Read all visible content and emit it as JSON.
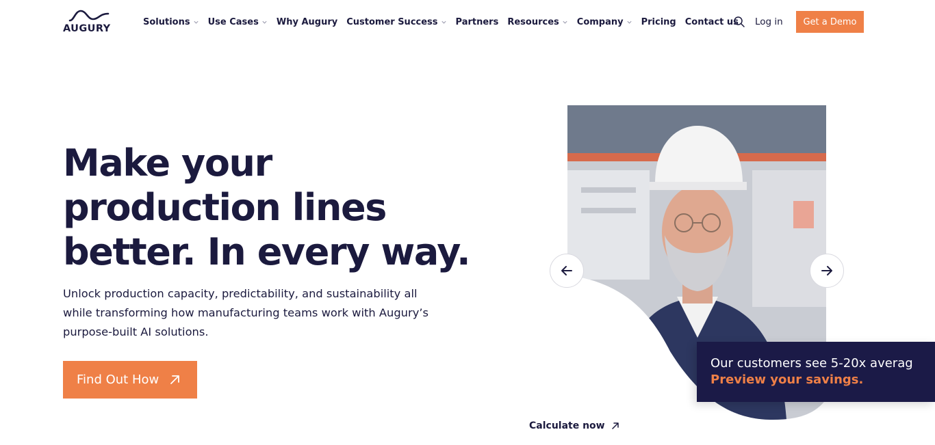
{
  "brand": {
    "name": "AUGURY",
    "accent_color": "#ef8047",
    "navy_color": "#1b1a3e"
  },
  "nav": {
    "items": [
      {
        "label": "Solutions",
        "has_dropdown": true
      },
      {
        "label": "Use Cases",
        "has_dropdown": true
      },
      {
        "label": "Why Augury",
        "has_dropdown": false
      },
      {
        "label": "Customer Success",
        "has_dropdown": true
      },
      {
        "label": "Partners",
        "has_dropdown": false
      },
      {
        "label": "Resources",
        "has_dropdown": true
      },
      {
        "label": "Company",
        "has_dropdown": true
      },
      {
        "label": "Pricing",
        "has_dropdown": false
      },
      {
        "label": "Contact us",
        "has_dropdown": false
      }
    ],
    "search_icon": "search-icon",
    "login_label": "Log in",
    "demo_label": "Get a Demo"
  },
  "hero": {
    "headline_lines": [
      "Make your",
      "production lines",
      "better. In every way."
    ],
    "subtext": "Unlock production capacity, predictability, and sustainability all while transforming how manufacturing teams work with Augury’s purpose-built AI solutions.",
    "cta_label": "Find Out How",
    "cta_icon": "arrow-up-right-icon"
  },
  "carousel": {
    "prev_icon": "arrow-left-icon",
    "next_icon": "arrow-right-icon"
  },
  "banner": {
    "line": "Our customers see 5-20x averag",
    "link": "Preview your savings."
  },
  "calculate": {
    "label": "Calculate now",
    "icon": "arrow-up-right-icon"
  }
}
